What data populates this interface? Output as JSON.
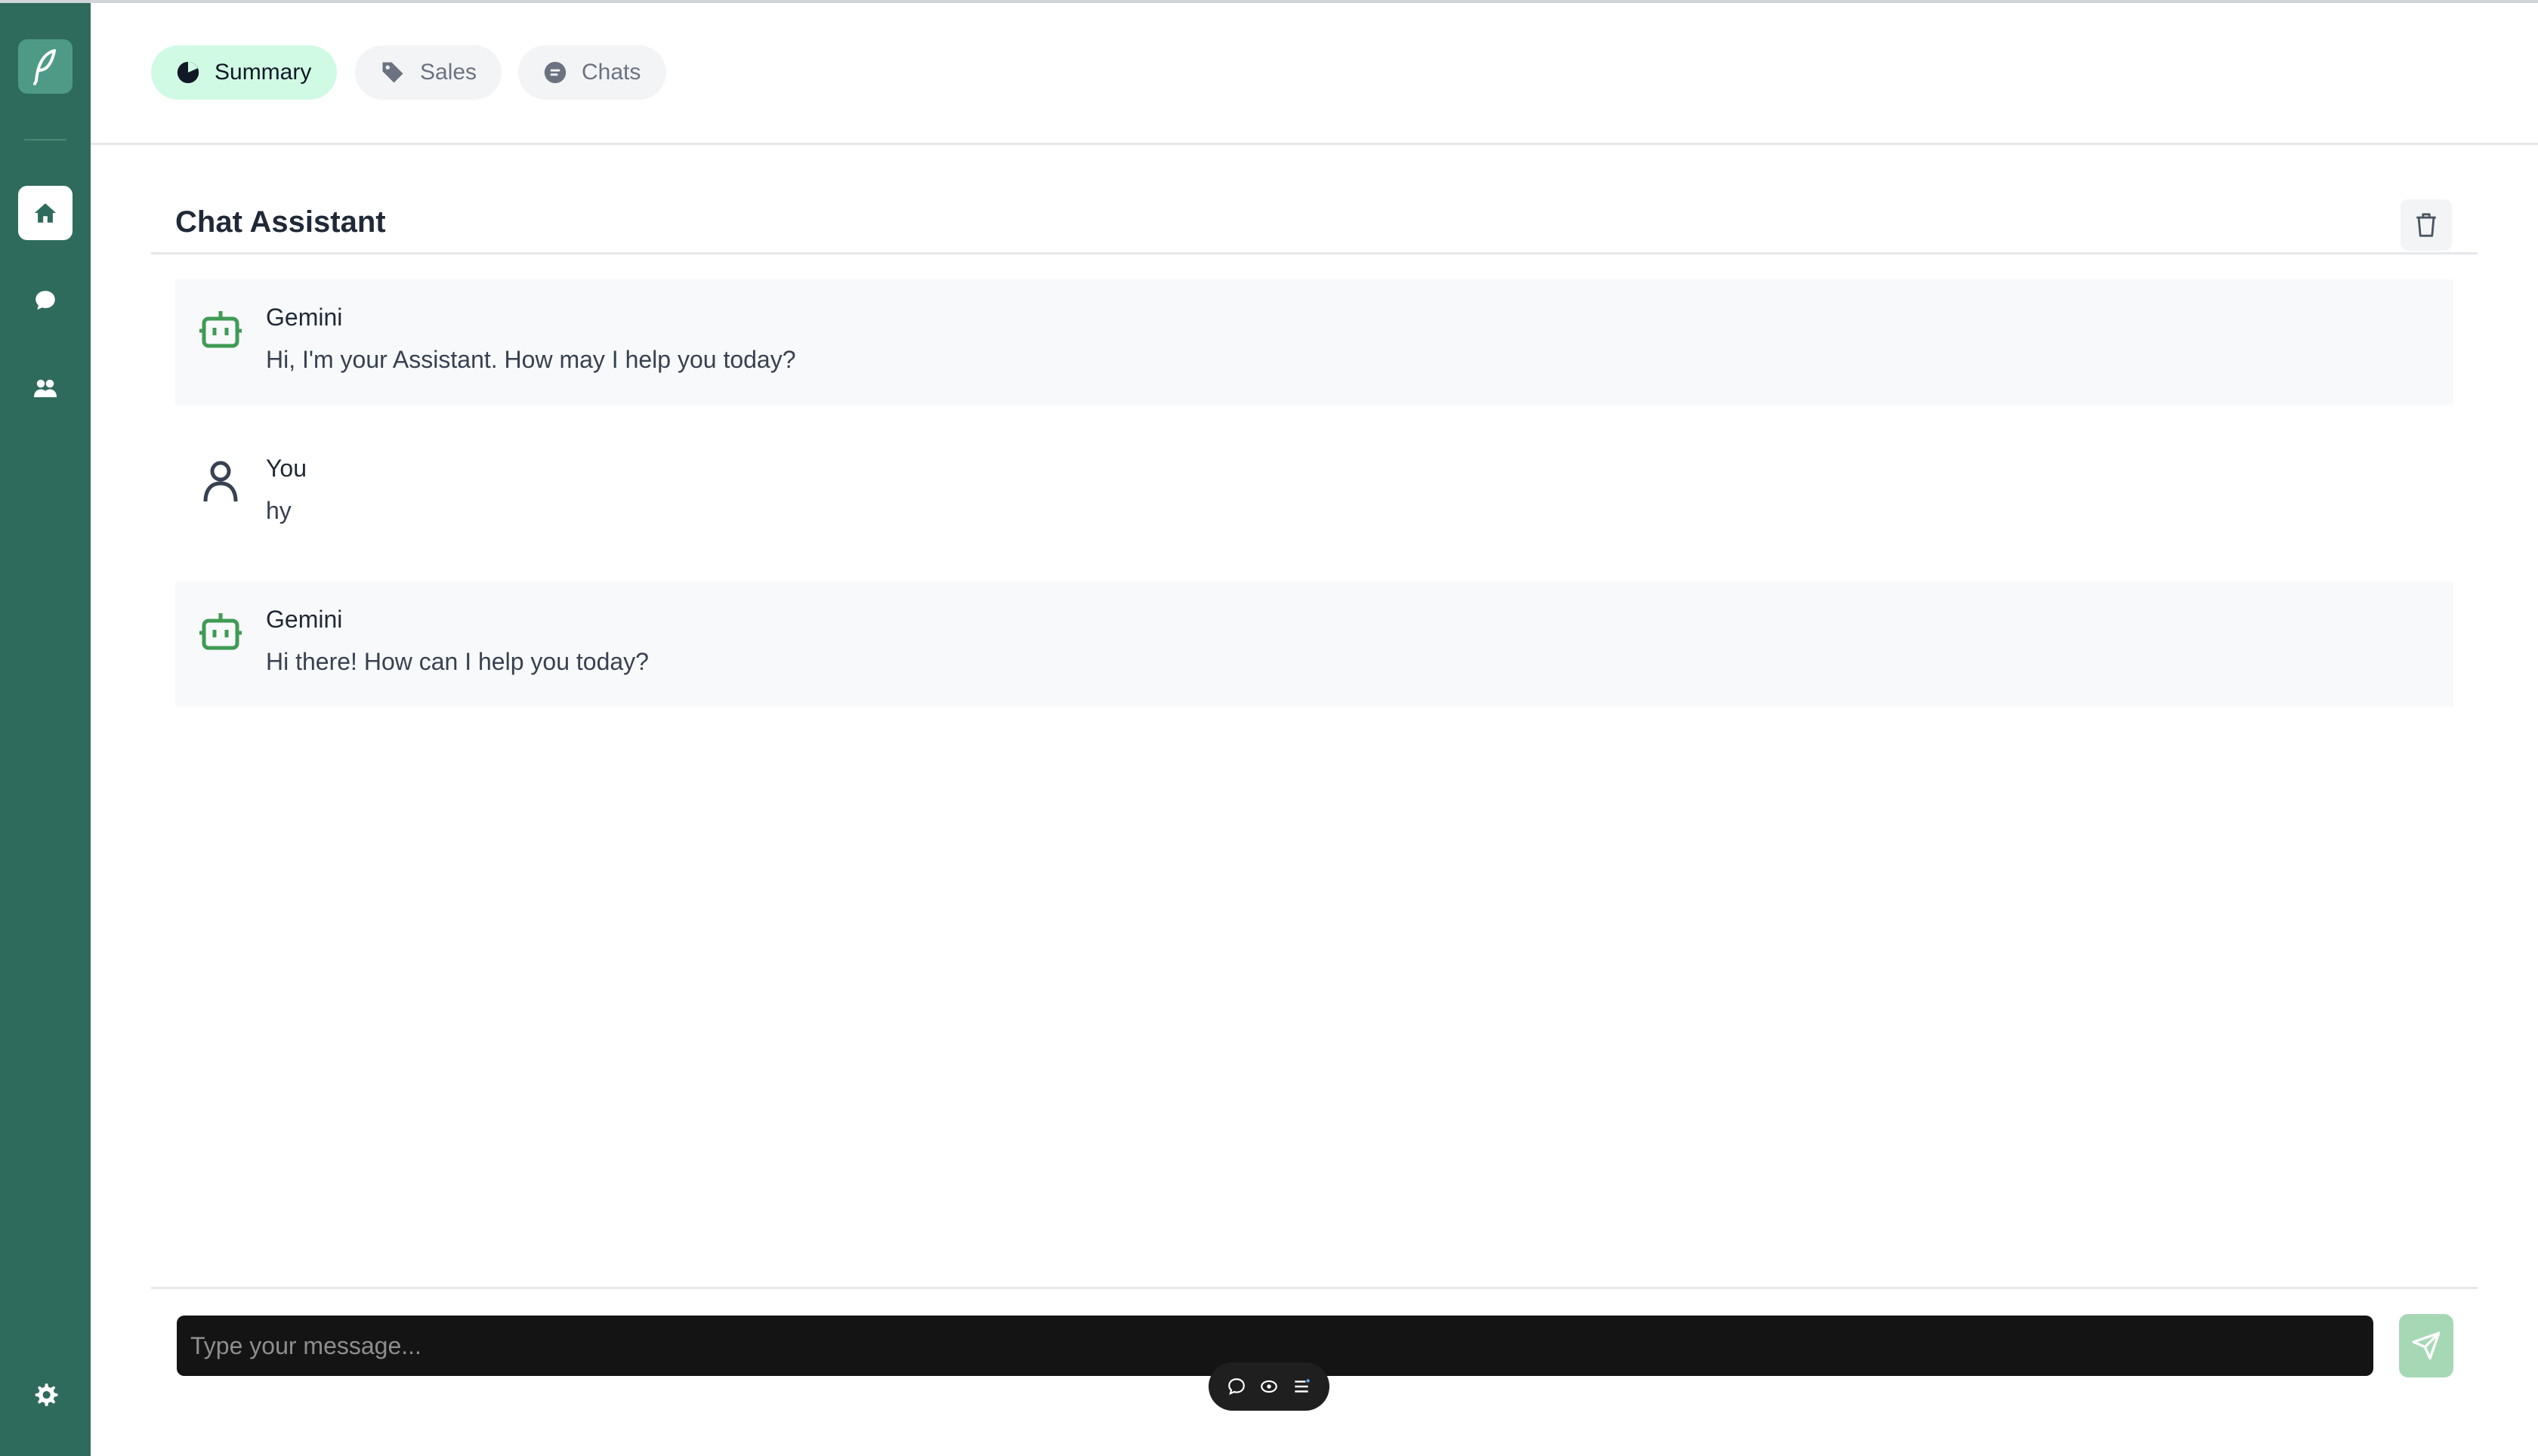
{
  "sidebar": {
    "logo_icon": "feather-logo-icon",
    "items": [
      {
        "name": "home",
        "icon": "home-icon",
        "active": true
      },
      {
        "name": "chat",
        "icon": "chat-bubble-icon",
        "active": false
      },
      {
        "name": "users",
        "icon": "users-icon",
        "active": false
      }
    ],
    "settings_icon": "gear-icon"
  },
  "header": {
    "tabs": [
      {
        "label": "Summary",
        "icon": "pie-chart-icon",
        "active": true
      },
      {
        "label": "Sales",
        "icon": "tag-icon",
        "active": false
      },
      {
        "label": "Chats",
        "icon": "chat-bubble-icon",
        "active": false
      }
    ]
  },
  "chat": {
    "title": "Chat Assistant",
    "clear_icon": "trash-icon",
    "messages": [
      {
        "sender": "Gemini",
        "text": "Hi, I'm your Assistant. How may I help you today?",
        "role": "bot"
      },
      {
        "sender": "You",
        "text": "hy",
        "role": "user"
      },
      {
        "sender": "Gemini",
        "text": "Hi there! How can I help you today?",
        "role": "bot"
      }
    ],
    "input": {
      "placeholder": "Type your message...",
      "value": ""
    },
    "send_icon": "send-icon"
  },
  "floating_toolbar": {
    "icons": [
      "comment-icon",
      "eye-icon",
      "list-icon"
    ]
  },
  "colors": {
    "sidebar": "#2e6b5c",
    "active_tab": "#d1fae5",
    "bot_icon": "#3f9b54",
    "send_button": "#a7d8b5"
  }
}
